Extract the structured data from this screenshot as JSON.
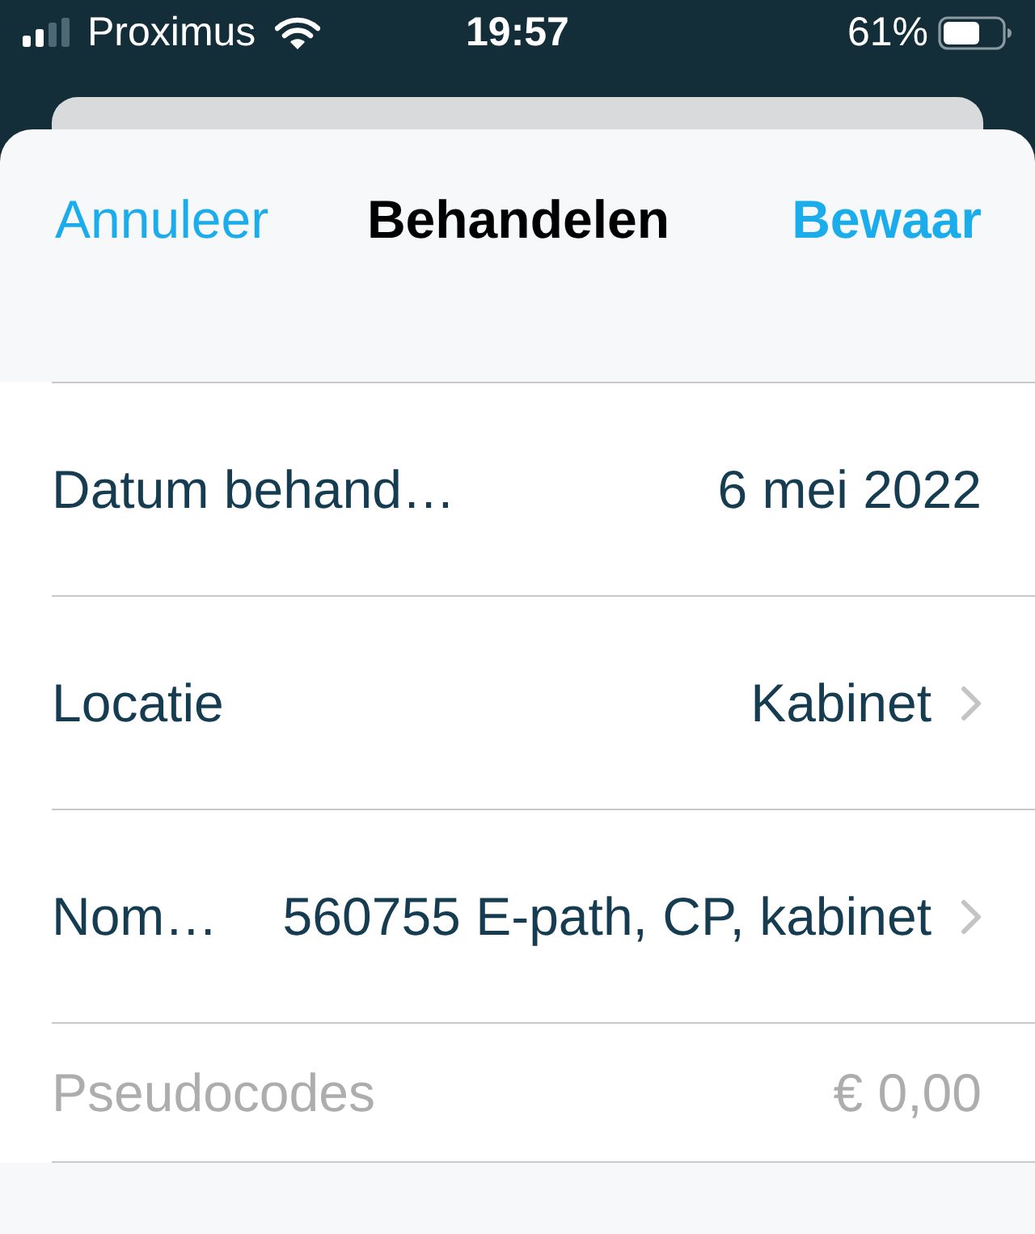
{
  "status_bar": {
    "carrier": "Proximus",
    "time": "19:57",
    "battery": "61%"
  },
  "nav_bar": {
    "cancel": "Annuleer",
    "title": "Behandelen",
    "save": "Bewaar"
  },
  "rows": [
    {
      "kind": "value",
      "label": "Datum behand…",
      "value": "6 mei 2022",
      "disabled": false
    },
    {
      "kind": "disclosure",
      "label": "Locatie",
      "value": "Kabinet",
      "disabled": false
    },
    {
      "kind": "disclosure",
      "label": "Nom…",
      "value": "560755 E-path, CP, kabinet",
      "disabled": false
    },
    {
      "kind": "total",
      "label": "Pseudocodes",
      "value": "€ 0,00",
      "disabled": true
    }
  ]
}
